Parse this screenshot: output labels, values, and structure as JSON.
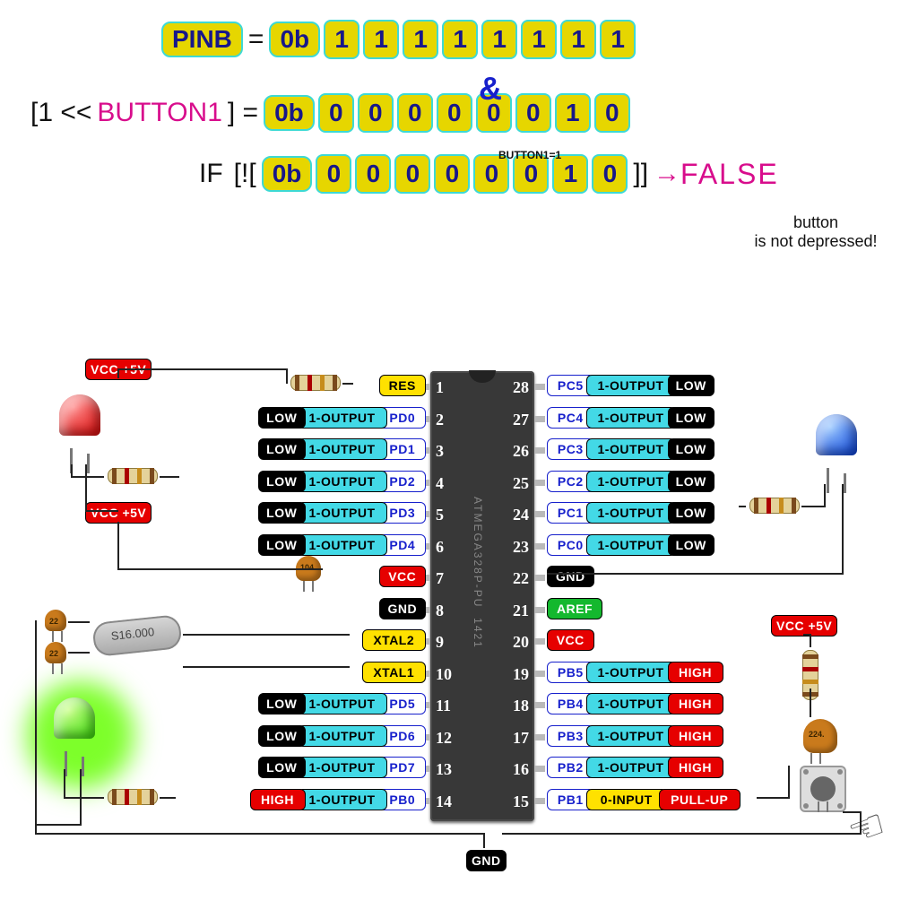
{
  "code": {
    "pinb_label": "PINB",
    "equals": "=",
    "prefix": "0b",
    "pinb_bits": [
      "1",
      "1",
      "1",
      "1",
      "1",
      "1",
      "1",
      "1"
    ],
    "and_symbol": "&",
    "shift_open": "[1 <<",
    "shift_var": "BUTTON1",
    "shift_close": "] =",
    "mask_bits": [
      "0",
      "0",
      "0",
      "0",
      "0",
      "0",
      "1",
      "0"
    ],
    "button_note": "BUTTON1=1",
    "if_label": "IF",
    "if_open": "[![",
    "result_bits": [
      "0",
      "0",
      "0",
      "0",
      "0",
      "0",
      "1",
      "0"
    ],
    "if_close": "]]",
    "arrow": "→",
    "false_label": "FALSE",
    "caption_l1": "button",
    "caption_l2": "is not depressed!"
  },
  "ic": {
    "name": "ATMEGA328P-PU",
    "date": "1421"
  },
  "left_pins": [
    {
      "n": "1",
      "tags": [
        {
          "cls": "t-yellow",
          "t": "RES"
        }
      ],
      "res": true
    },
    {
      "n": "2",
      "tags": [
        {
          "cls": "t-black",
          "t": "LOW"
        },
        {
          "cls": "t-cyan",
          "t": "1-OUTPUT"
        },
        {
          "cls": "t-white",
          "t": "PD0"
        }
      ]
    },
    {
      "n": "3",
      "tags": [
        {
          "cls": "t-black",
          "t": "LOW"
        },
        {
          "cls": "t-cyan",
          "t": "1-OUTPUT"
        },
        {
          "cls": "t-white",
          "t": "PD1"
        }
      ]
    },
    {
      "n": "4",
      "tags": [
        {
          "cls": "t-black",
          "t": "LOW"
        },
        {
          "cls": "t-cyan",
          "t": "1-OUTPUT"
        },
        {
          "cls": "t-white",
          "t": "PD2"
        }
      ]
    },
    {
      "n": "5",
      "tags": [
        {
          "cls": "t-black",
          "t": "LOW"
        },
        {
          "cls": "t-cyan",
          "t": "1-OUTPUT"
        },
        {
          "cls": "t-white",
          "t": "PD3"
        }
      ]
    },
    {
      "n": "6",
      "tags": [
        {
          "cls": "t-black",
          "t": "LOW"
        },
        {
          "cls": "t-cyan",
          "t": "1-OUTPUT"
        },
        {
          "cls": "t-white",
          "t": "PD4"
        }
      ]
    },
    {
      "n": "7",
      "tags": [
        {
          "cls": "t-red",
          "t": "VCC"
        }
      ]
    },
    {
      "n": "8",
      "tags": [
        {
          "cls": "t-black",
          "t": "GND"
        }
      ]
    },
    {
      "n": "9",
      "tags": [
        {
          "cls": "t-yellow",
          "t": "XTAL2"
        }
      ]
    },
    {
      "n": "10",
      "tags": [
        {
          "cls": "t-yellow",
          "t": "XTAL1"
        }
      ]
    },
    {
      "n": "11",
      "tags": [
        {
          "cls": "t-black",
          "t": "LOW"
        },
        {
          "cls": "t-cyan",
          "t": "1-OUTPUT"
        },
        {
          "cls": "t-white",
          "t": "PD5"
        }
      ]
    },
    {
      "n": "12",
      "tags": [
        {
          "cls": "t-black",
          "t": "LOW"
        },
        {
          "cls": "t-cyan",
          "t": "1-OUTPUT"
        },
        {
          "cls": "t-white",
          "t": "PD6"
        }
      ]
    },
    {
      "n": "13",
      "tags": [
        {
          "cls": "t-black",
          "t": "LOW"
        },
        {
          "cls": "t-cyan",
          "t": "1-OUTPUT"
        },
        {
          "cls": "t-white",
          "t": "PD7"
        }
      ]
    },
    {
      "n": "14",
      "tags": [
        {
          "cls": "t-red",
          "t": "HIGH"
        },
        {
          "cls": "t-cyan",
          "t": "1-OUTPUT"
        },
        {
          "cls": "t-white",
          "t": "PB0"
        }
      ]
    }
  ],
  "right_pins": [
    {
      "n": "28",
      "tags": [
        {
          "cls": "t-white",
          "t": "PC5"
        },
        {
          "cls": "t-cyan",
          "t": "1-OUTPUT"
        },
        {
          "cls": "t-black",
          "t": "LOW"
        }
      ]
    },
    {
      "n": "27",
      "tags": [
        {
          "cls": "t-white",
          "t": "PC4"
        },
        {
          "cls": "t-cyan",
          "t": "1-OUTPUT"
        },
        {
          "cls": "t-black",
          "t": "LOW"
        }
      ]
    },
    {
      "n": "26",
      "tags": [
        {
          "cls": "t-white",
          "t": "PC3"
        },
        {
          "cls": "t-cyan",
          "t": "1-OUTPUT"
        },
        {
          "cls": "t-black",
          "t": "LOW"
        }
      ]
    },
    {
      "n": "25",
      "tags": [
        {
          "cls": "t-white",
          "t": "PC2"
        },
        {
          "cls": "t-cyan",
          "t": "1-OUTPUT"
        },
        {
          "cls": "t-black",
          "t": "LOW"
        }
      ]
    },
    {
      "n": "24",
      "tags": [
        {
          "cls": "t-white",
          "t": "PC1"
        },
        {
          "cls": "t-cyan",
          "t": "1-OUTPUT"
        },
        {
          "cls": "t-black",
          "t": "LOW"
        }
      ]
    },
    {
      "n": "23",
      "tags": [
        {
          "cls": "t-white",
          "t": "PC0"
        },
        {
          "cls": "t-cyan",
          "t": "1-OUTPUT"
        },
        {
          "cls": "t-black",
          "t": "LOW"
        }
      ]
    },
    {
      "n": "22",
      "tags": [
        {
          "cls": "t-black",
          "t": "GND"
        }
      ]
    },
    {
      "n": "21",
      "tags": [
        {
          "cls": "t-green",
          "t": "AREF"
        }
      ]
    },
    {
      "n": "20",
      "tags": [
        {
          "cls": "t-red",
          "t": "VCC"
        }
      ]
    },
    {
      "n": "19",
      "tags": [
        {
          "cls": "t-white",
          "t": "PB5"
        },
        {
          "cls": "t-cyan",
          "t": "1-OUTPUT"
        },
        {
          "cls": "t-red",
          "t": "HIGH"
        }
      ]
    },
    {
      "n": "18",
      "tags": [
        {
          "cls": "t-white",
          "t": "PB4"
        },
        {
          "cls": "t-cyan",
          "t": "1-OUTPUT"
        },
        {
          "cls": "t-red",
          "t": "HIGH"
        }
      ]
    },
    {
      "n": "17",
      "tags": [
        {
          "cls": "t-white",
          "t": "PB3"
        },
        {
          "cls": "t-cyan",
          "t": "1-OUTPUT"
        },
        {
          "cls": "t-red",
          "t": "HIGH"
        }
      ]
    },
    {
      "n": "16",
      "tags": [
        {
          "cls": "t-white",
          "t": "PB2"
        },
        {
          "cls": "t-cyan",
          "t": "1-OUTPUT"
        },
        {
          "cls": "t-red",
          "t": "HIGH"
        }
      ]
    },
    {
      "n": "15",
      "tags": [
        {
          "cls": "t-white",
          "t": "PB1"
        },
        {
          "cls": "t-yellow",
          "t": "0-INPUT"
        },
        {
          "cls": "t-red",
          "t": "PULL-UP"
        }
      ]
    }
  ],
  "rails": {
    "vcc": "VCC +5V",
    "gnd": "GND"
  },
  "components": {
    "crystal": "S16.000",
    "cap22": "22",
    "cap104": "104",
    "cap224": "224."
  }
}
